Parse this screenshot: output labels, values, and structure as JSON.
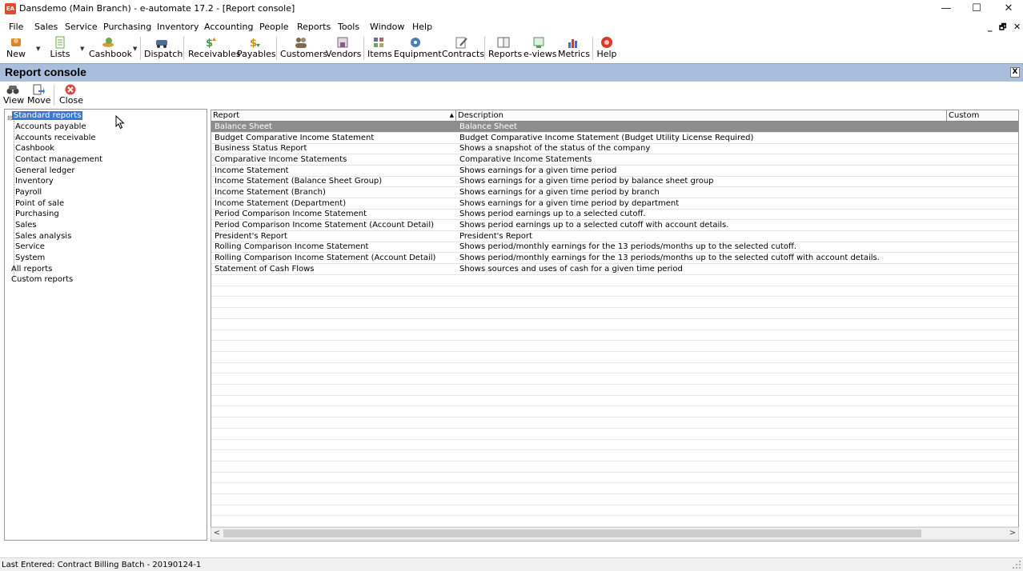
{
  "window": {
    "title": "Dansdemo (Main Branch) - e-automate 17.2 - [Report console]",
    "app_icon_text": "EA",
    "controls": {
      "minimize": "—",
      "maximize": "☐",
      "close": "✕"
    },
    "mdi_controls": {
      "minimize": "_",
      "restore": "🗗",
      "close": "✕"
    }
  },
  "menu": [
    "File",
    "Sales",
    "Service",
    "Purchasing",
    "Inventory",
    "Accounting",
    "People",
    "Reports",
    "Tools",
    "Window",
    "Help"
  ],
  "toolbar": [
    {
      "label": "New",
      "icon": "new-icon",
      "color": "#d9862b"
    },
    {
      "label": "Lists",
      "icon": "lists-icon",
      "color": "#6fa84a"
    },
    {
      "label": "Cashbook",
      "icon": "cashbook-icon",
      "color": "#d8a03a"
    },
    {
      "label": "Dispatch",
      "icon": "dispatch-icon",
      "color": "#4a6f9a"
    },
    {
      "label": "Receivables",
      "icon": "receivables-icon",
      "color": "#3f9b3f"
    },
    {
      "label": "Payables",
      "icon": "payables-icon",
      "color": "#c8902a"
    },
    {
      "label": "Customers",
      "icon": "customers-icon",
      "color": "#7c6a52"
    },
    {
      "label": "Vendors",
      "icon": "vendors-icon",
      "color": "#8b5a8b"
    },
    {
      "label": "Items",
      "icon": "items-icon",
      "color": "#6a6aa8"
    },
    {
      "label": "Equipment",
      "icon": "equipment-icon",
      "color": "#4a7fb8"
    },
    {
      "label": "Contracts",
      "icon": "contracts-icon",
      "color": "#777777"
    },
    {
      "label": "Reports",
      "icon": "reports-icon",
      "color": "#666666"
    },
    {
      "label": "e-views",
      "icon": "eviews-icon",
      "color": "#5a9a5a"
    },
    {
      "label": "Metrics",
      "icon": "metrics-icon",
      "color": "#4a6fb8"
    },
    {
      "label": "Help",
      "icon": "help-icon",
      "color": "#d93a2a"
    }
  ],
  "console": {
    "title": "Report console",
    "close_label": "X",
    "buttons": [
      {
        "label": "View",
        "icon": "binoculars-icon"
      },
      {
        "label": "Move",
        "icon": "move-icon"
      },
      {
        "label": "Close",
        "icon": "close-circle-icon"
      }
    ]
  },
  "tree": {
    "root": "Standard reports",
    "children": [
      "Accounts payable",
      "Accounts receivable",
      "Cashbook",
      "Contact management",
      "General ledger",
      "Inventory",
      "Payroll",
      "Point of sale",
      "Purchasing",
      "Sales",
      "Sales analysis",
      "Service",
      "System"
    ],
    "others": [
      "All reports",
      "Custom reports"
    ]
  },
  "grid": {
    "columns": [
      "Report",
      "Description",
      "Custom"
    ],
    "rows": [
      {
        "report": "Balance Sheet",
        "description": "Balance Sheet",
        "custom": ""
      },
      {
        "report": "Budget Comparative Income Statement",
        "description": "Budget Comparative Income Statement (Budget Utility License Required)",
        "custom": ""
      },
      {
        "report": "Business Status Report",
        "description": "Shows a snapshot of the status of the company",
        "custom": ""
      },
      {
        "report": "Comparative Income Statements",
        "description": "Comparative Income Statements",
        "custom": ""
      },
      {
        "report": "Income Statement",
        "description": "Shows earnings for a given time period",
        "custom": ""
      },
      {
        "report": "Income Statement (Balance Sheet Group)",
        "description": "Shows earnings for a given time period by balance sheet group",
        "custom": ""
      },
      {
        "report": "Income Statement (Branch)",
        "description": "Shows earnings for a given time period by branch",
        "custom": ""
      },
      {
        "report": "Income Statement (Department)",
        "description": "Shows earnings for a given time period by department",
        "custom": ""
      },
      {
        "report": "Period Comparison Income Statement",
        "description": "Shows period earnings up to a selected cutoff.",
        "custom": ""
      },
      {
        "report": "Period Comparison Income Statement (Account Detail)",
        "description": "Shows period earnings up to a selected cutoff with account details.",
        "custom": ""
      },
      {
        "report": "President's Report",
        "description": "President's Report",
        "custom": ""
      },
      {
        "report": "Rolling Comparison Income Statement",
        "description": "Shows period/monthly earnings for the 13 periods/months up to the selected cutoff.",
        "custom": ""
      },
      {
        "report": "Rolling Comparison Income Statement (Account Detail)",
        "description": "Shows period/monthly earnings for the 13 periods/months up to the selected cutoff with account details.",
        "custom": ""
      },
      {
        "report": "Statement of Cash Flows",
        "description": "Shows sources and uses of cash for a given time period",
        "custom": ""
      }
    ]
  },
  "scrollbar": {
    "left_arrow": "<",
    "right_arrow": ">"
  },
  "status": {
    "text": "Last Entered: Contract Billing Batch - 20190124-1"
  },
  "colors": {
    "header_band": "#a8bedc",
    "tree_selection": "#3a78d6",
    "row_selection": "#8e8e8e"
  }
}
